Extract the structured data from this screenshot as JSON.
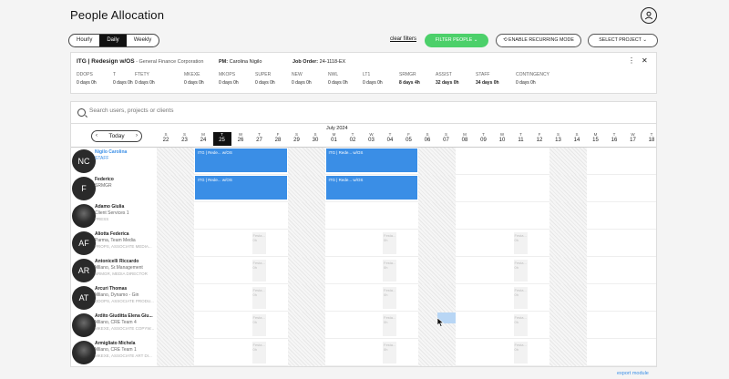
{
  "page": {
    "title": "People Allocation"
  },
  "toolbar": {
    "views": [
      "Hourly",
      "Daily",
      "Weekly"
    ],
    "active_view": "Daily",
    "clear_filters": "clear filters",
    "filter_people": "FILTER PEOPLE",
    "recurring": "ENABLE RECURRING MODE",
    "select_project": "SELECT PROJECT"
  },
  "project": {
    "name": "ITG | Redesign w/OS",
    "client": " - General Finance Corporation",
    "pm_label": "PM:",
    "pm": "Carolina Nigilo",
    "job_label": "Job Order:",
    "job": "24-1118-EX",
    "stats": [
      {
        "label": "DDOPS",
        "value": "0 days 0h",
        "bold": false
      },
      {
        "label": "T",
        "value": "0 days 0h",
        "bold": false
      },
      {
        "label": "FTETY",
        "value": "0 days 0h",
        "bold": false
      },
      {
        "label": "MKEXE",
        "value": "0 days 0h",
        "bold": false
      },
      {
        "label": "MKOPS",
        "value": "0 days 0h",
        "bold": false
      },
      {
        "label": "SUPER",
        "value": "0 days 0h",
        "bold": false
      },
      {
        "label": "NEW",
        "value": "0 days 0h",
        "bold": false
      },
      {
        "label": "NWL",
        "value": "0 days 0h",
        "bold": false
      },
      {
        "label": "LT1",
        "value": "0 days 0h",
        "bold": false
      },
      {
        "label": "SRMGR",
        "value": "8 days 4h",
        "bold": true
      },
      {
        "label": "ASSIST",
        "value": "32 days 0h",
        "bold": true
      },
      {
        "label": "STAFF",
        "value": "34 days 0h",
        "bold": true
      },
      {
        "label": "CONTINGENCY",
        "value": "0 days 0h",
        "bold": false
      }
    ]
  },
  "search": {
    "placeholder": "Search users, projects or clients"
  },
  "calendar": {
    "today_label": "Today",
    "month": "July 2024",
    "days": [
      {
        "l": "S",
        "n": "22"
      },
      {
        "l": "S",
        "n": "23"
      },
      {
        "l": "M",
        "n": "24"
      },
      {
        "l": "T",
        "n": "25"
      },
      {
        "l": "W",
        "n": "26"
      },
      {
        "l": "T",
        "n": "27"
      },
      {
        "l": "F",
        "n": "28"
      },
      {
        "l": "S",
        "n": "29"
      },
      {
        "l": "S",
        "n": "30"
      },
      {
        "l": "M",
        "n": "01"
      },
      {
        "l": "T",
        "n": "02"
      },
      {
        "l": "W",
        "n": "03"
      },
      {
        "l": "T",
        "n": "04"
      },
      {
        "l": "F",
        "n": "05"
      },
      {
        "l": "S",
        "n": "06"
      },
      {
        "l": "S",
        "n": "07"
      },
      {
        "l": "M",
        "n": "08"
      },
      {
        "l": "T",
        "n": "09"
      },
      {
        "l": "W",
        "n": "10"
      },
      {
        "l": "T",
        "n": "11"
      },
      {
        "l": "F",
        "n": "12"
      },
      {
        "l": "S",
        "n": "13"
      },
      {
        "l": "S",
        "n": "14"
      },
      {
        "l": "M",
        "n": "15"
      },
      {
        "l": "T",
        "n": "16"
      },
      {
        "l": "W",
        "n": "17"
      },
      {
        "l": "T",
        "n": "18"
      }
    ],
    "today_index": 3
  },
  "bar_label": "ITG | Rede... w/OS",
  "holiday_label": "Festa... 0h",
  "people": [
    {
      "initials": "NC",
      "photo": false,
      "name": "Nigilo Carolina",
      "role": "STAFF",
      "dept": "",
      "hl": true,
      "bars": true,
      "hols": []
    },
    {
      "initials": "F",
      "photo": false,
      "name": "Federico",
      "role": "SRMGR",
      "dept": "",
      "hl": false,
      "bars": true,
      "hols": []
    },
    {
      "initials": "",
      "photo": true,
      "name": "Adamo Giulia",
      "role": "Client Services 1",
      "dept": "PRESS",
      "hl": false,
      "bars": false,
      "hols": []
    },
    {
      "initials": "AF",
      "photo": false,
      "name": "Aliotta Federica",
      "role": "Parma, Team Media",
      "dept": "PROPS, ASSOCIATE MEDIA...",
      "hl": false,
      "bars": false,
      "hols": [
        5,
        12,
        19
      ]
    },
    {
      "initials": "AR",
      "photo": false,
      "name": "Antonicelli Riccardo",
      "role": "Milano, Sr.Management",
      "dept": "SRMGR, MEDIA DIRECTOR",
      "hl": false,
      "bars": false,
      "hols": [
        5,
        12,
        19
      ]
    },
    {
      "initials": "AT",
      "photo": false,
      "name": "Arcuri Thomas",
      "role": "Milano, Dynamo - Gin",
      "dept": "DDOPS, ASSOCIATE PRODU...",
      "hl": false,
      "bars": false,
      "hols": [
        5,
        12,
        19
      ]
    },
    {
      "initials": "",
      "photo": true,
      "name": "Ardito Giuditta Elena Giu...",
      "role": "Milano, CRE Team 4",
      "dept": "MKEXE, ASSOCIATE COPYW...",
      "hl": false,
      "bars": false,
      "hols": [
        5,
        12,
        19
      ]
    },
    {
      "initials": "",
      "photo": true,
      "name": "Armigliato Michela",
      "role": "Milano, CRE Team 1",
      "dept": "MKEXE, ASSOCIATE ART DI...",
      "hl": false,
      "bars": false,
      "hols": [
        5,
        12,
        19
      ]
    }
  ],
  "footer": {
    "export": "export module"
  }
}
